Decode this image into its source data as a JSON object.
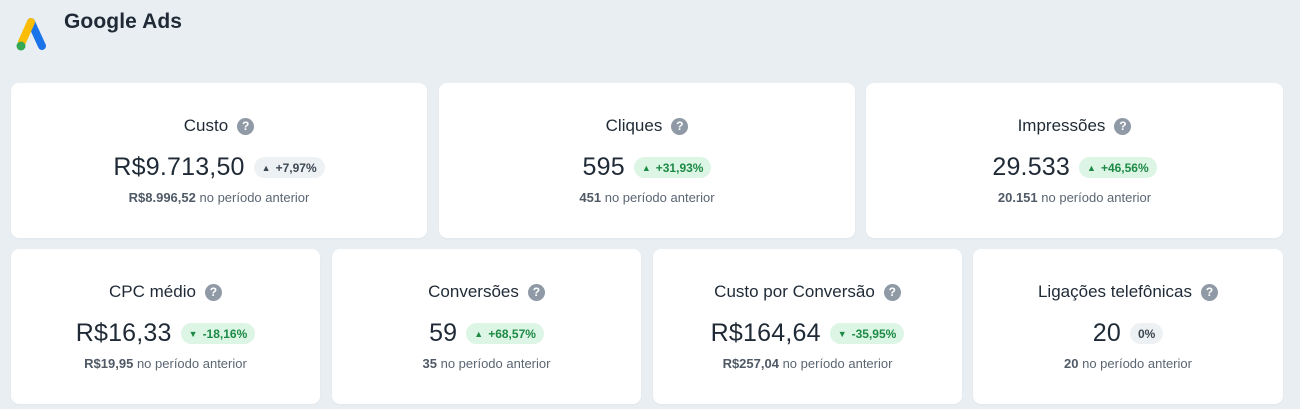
{
  "app": {
    "title": "Google Ads",
    "logo_icon": "google-ads-logo",
    "colors": {
      "background": "#e9eef2",
      "card": "#ffffff",
      "positive_badge_bg": "#dcf5e5",
      "positive_badge_text": "#1d8a45",
      "neutral_badge_bg": "#eef1f3",
      "help_icon": "#8f9aa6"
    }
  },
  "prev_suffix": "no período anterior",
  "metrics": [
    {
      "title": "Custo",
      "value": "R$9.713,50",
      "change": "+7,97%",
      "trend": "up",
      "sentiment": "neutral",
      "previous": "R$8.996,52"
    },
    {
      "title": "Cliques",
      "value": "595",
      "change": "+31,93%",
      "trend": "up",
      "sentiment": "good",
      "previous": "451"
    },
    {
      "title": "Impressões",
      "value": "29.533",
      "change": "+46,56%",
      "trend": "up",
      "sentiment": "good",
      "previous": "20.151"
    },
    {
      "title": "CPC médio",
      "value": "R$16,33",
      "change": "-18,16%",
      "trend": "down",
      "sentiment": "good",
      "previous": "R$19,95"
    },
    {
      "title": "Conversões",
      "value": "59",
      "change": "+68,57%",
      "trend": "up",
      "sentiment": "good",
      "previous": "35"
    },
    {
      "title": "Custo por Conversão",
      "value": "R$164,64",
      "change": "-35,95%",
      "trend": "down",
      "sentiment": "good",
      "previous": "R$257,04"
    },
    {
      "title": "Ligações telefônicas",
      "value": "20",
      "change": "0%",
      "trend": "none",
      "sentiment": "neutral",
      "previous": "20"
    }
  ]
}
